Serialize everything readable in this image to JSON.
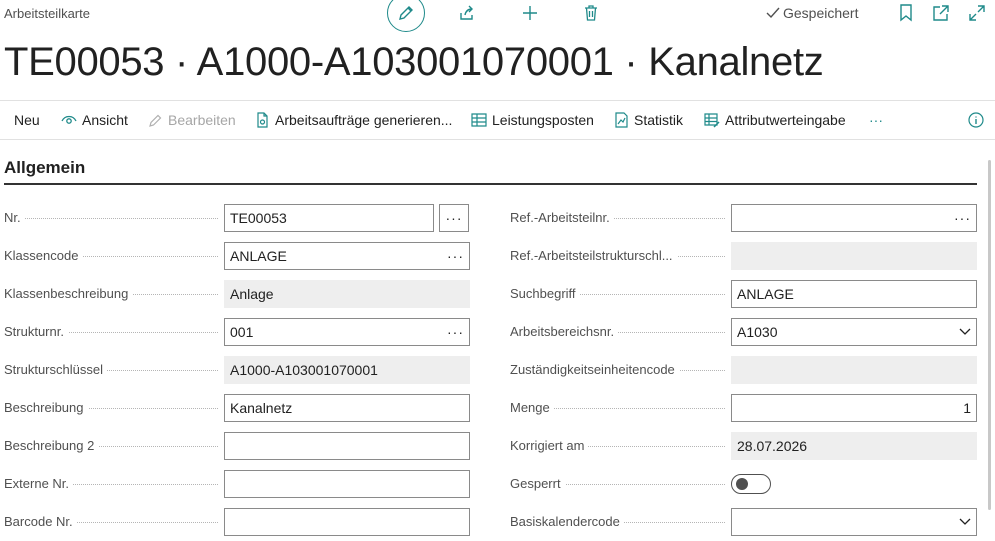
{
  "header": {
    "breadcrumb": "Arbeitsteilkarte",
    "saved_status": "Gespeichert",
    "title": "TE00053 · A1000-A103001070001 · Kanalnetz"
  },
  "actions": {
    "new": "Neu",
    "view": "Ansicht",
    "edit": "Bearbeiten",
    "generate_orders": "Arbeitsaufträge generieren...",
    "entries": "Leistungsposten",
    "statistics": "Statistik",
    "attributes": "Attributwerteingabe",
    "more": "···"
  },
  "section": {
    "title": "Allgemein"
  },
  "left_fields": [
    {
      "label": "Nr.",
      "value": "TE00053"
    },
    {
      "label": "Klassencode",
      "value": "ANLAGE"
    },
    {
      "label": "Klassenbeschreibung",
      "value": "Anlage"
    },
    {
      "label": "Strukturnr.",
      "value": "001"
    },
    {
      "label": "Strukturschlüssel",
      "value": "A1000-A103001070001"
    },
    {
      "label": "Beschreibung",
      "value": "Kanalnetz"
    },
    {
      "label": "Beschreibung 2",
      "value": ""
    },
    {
      "label": "Externe Nr.",
      "value": ""
    },
    {
      "label": "Barcode Nr.",
      "value": ""
    }
  ],
  "right_fields": [
    {
      "label": "Ref.-Arbeitsteilnr.",
      "value": ""
    },
    {
      "label": "Ref.-Arbeitsteilstrukturschl...",
      "value": ""
    },
    {
      "label": "Suchbegriff",
      "value": "ANLAGE"
    },
    {
      "label": "Arbeitsbereichsnr.",
      "value": "A1030"
    },
    {
      "label": "Zuständigkeitseinheitencode",
      "value": ""
    },
    {
      "label": "Menge",
      "value": "1"
    },
    {
      "label": "Korrigiert am",
      "value": "28.07.2026"
    },
    {
      "label": "Gesperrt",
      "value": ""
    },
    {
      "label": "Basiskalendercode",
      "value": ""
    }
  ],
  "gesperrt_on": false,
  "colors": {
    "accent": "#1f8a8a",
    "text": "#212121",
    "muted": "#505050",
    "readonly_bg": "#eeeeee"
  }
}
